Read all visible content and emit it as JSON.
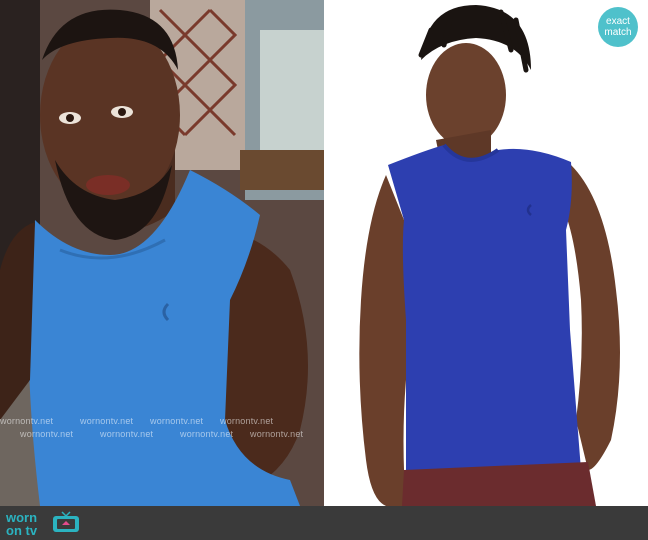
{
  "badge": {
    "label": "exact\nmatch"
  },
  "watermark": {
    "text": "wornontv.net"
  },
  "brand": {
    "line1": "worn",
    "line2": "on tv"
  },
  "colors": {
    "shirt_left": "#3a85d4",
    "shirt_right": "#2d3fb0",
    "accent": "#4fc1cb"
  }
}
